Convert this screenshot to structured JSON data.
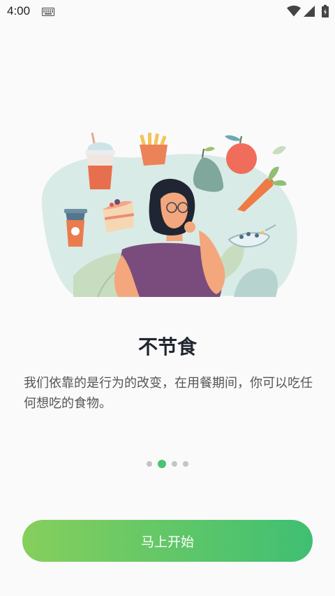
{
  "status_bar": {
    "time": "4:00",
    "icons": [
      "keyboard-icon",
      "wifi-icon",
      "signal-icon",
      "battery-icon"
    ]
  },
  "onboarding": {
    "illustration": "woman-thinking-about-food",
    "title": "不节食",
    "description": "我们依靠的是行为的改变，在用餐期间，你可以吃任何想吃的食物。",
    "pager": {
      "total": 4,
      "current": 2
    },
    "start_button": "马上开始"
  },
  "colors": {
    "accent": "#4cc372",
    "button_gradient_start": "#86cf5c",
    "button_gradient_end": "#3fbf73",
    "title": "#1f2630",
    "description": "#555555"
  }
}
